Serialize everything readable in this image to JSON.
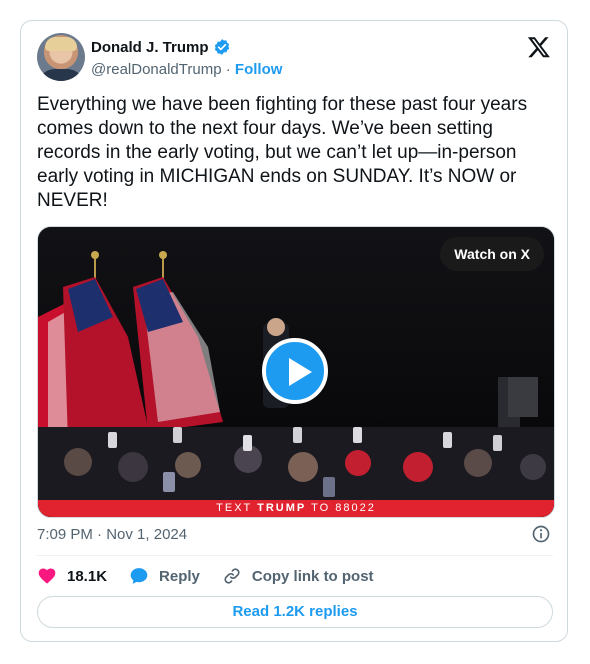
{
  "author": {
    "display_name": "Donald J. Trump",
    "handle": "@realDonaldTrump",
    "separator": "·",
    "follow_label": "Follow"
  },
  "tweet": {
    "text": "Everything we have been fighting for these past four years comes down to the next four days. We’ve been setting records in the early voting, but we can’t let up—in-person early voting in MICHIGAN ends on SUNDAY. It’s NOW or NEVER!",
    "time": "7:09 PM",
    "date_separator": "·",
    "date": "Nov 1, 2024"
  },
  "media": {
    "watch_label": "Watch on X",
    "banner_prefix": "TEXT ",
    "banner_keyword": "TRUMP",
    "banner_suffix": " TO 88022"
  },
  "actions": {
    "likes_count": "18.1K",
    "reply_label": "Reply",
    "copy_label": "Copy link to post"
  },
  "read_replies_label": "Read 1.2K replies",
  "colors": {
    "accent": "#1d9bf0",
    "like": "#f91880",
    "banner": "#e0232e",
    "muted_text": "#536471"
  },
  "icons": [
    "verified-badge-icon",
    "x-logo-icon",
    "play-icon",
    "info-icon",
    "heart-icon",
    "reply-bubble-icon",
    "link-icon"
  ]
}
